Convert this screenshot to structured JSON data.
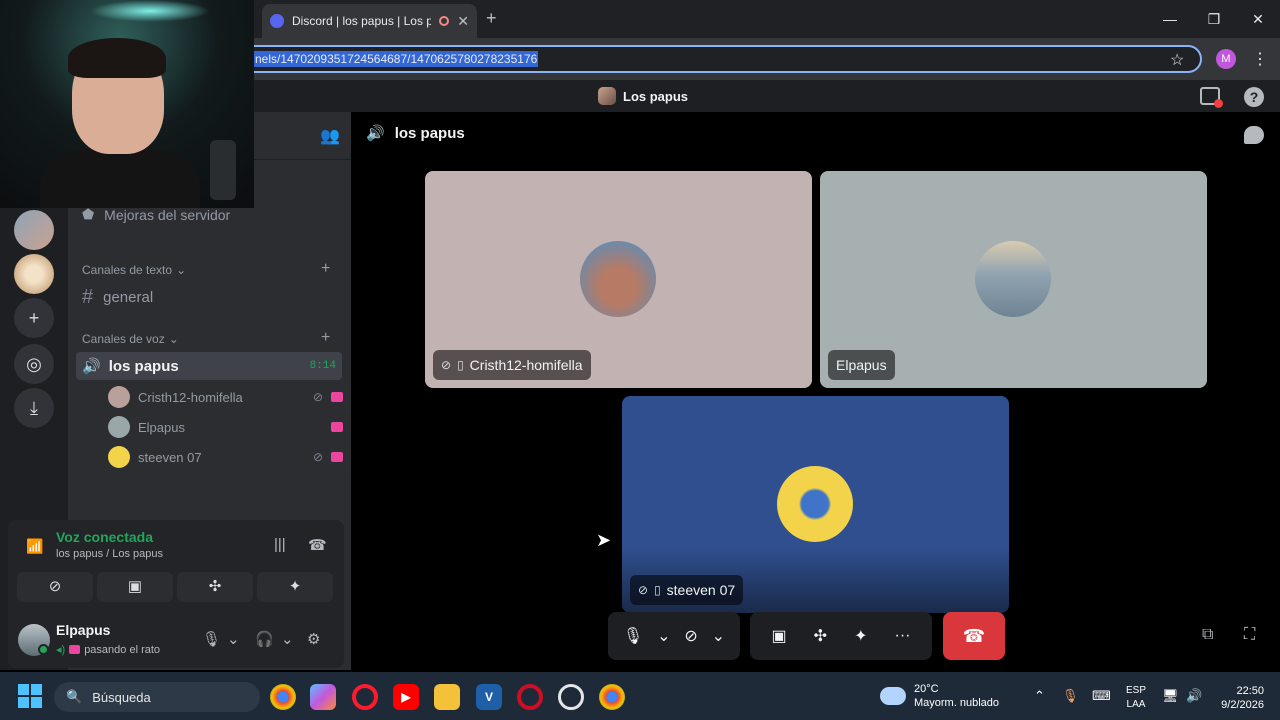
{
  "browser": {
    "tab_title": "Discord | los papus | Los papus",
    "new_tab": "+",
    "url": "nels/1470209351724564687/1470625780278235176",
    "profile_initial": "M",
    "window_controls": [
      "—",
      "❐",
      "✕"
    ]
  },
  "discord_titlebar": {
    "server_name": "Los papus"
  },
  "sidebar": {
    "boost_label": "Mejoras del servidor",
    "text_category": "Canales de texto",
    "text_channels": [
      "general"
    ],
    "voice_category": "Canales de voz",
    "voice_channel": {
      "name": "los papus",
      "timer": "8:14"
    },
    "voice_users": [
      {
        "name": "Cristh12-homifella",
        "muted_video": true,
        "live": true,
        "avatar_color": "#b9a09a"
      },
      {
        "name": "Elpapus",
        "muted_video": false,
        "live": true,
        "avatar_color": "#9aa7a8"
      },
      {
        "name": "steeven 07",
        "muted_video": true,
        "live": true,
        "avatar_color": "#f2d34a"
      }
    ]
  },
  "voice_panel": {
    "status": "Voz conectada",
    "location": "los papus / Los papus"
  },
  "user": {
    "name": "Elpapus",
    "activity": "pasando el rato"
  },
  "call": {
    "channel_title": "los papus",
    "tiles": [
      {
        "name": "Cristh12-homifella",
        "bg": "#c3b2b2",
        "show_icons": true
      },
      {
        "name": "Elpapus",
        "bg": "#a6b0b1",
        "show_icons": false
      },
      {
        "name": "steeven 07",
        "bg": "#2f4f8f",
        "show_icons": true
      }
    ]
  },
  "taskbar": {
    "search_placeholder": "Búsqueda",
    "weather_temp": "20°C",
    "weather_desc": "Mayorm. nublado",
    "lang_top": "ESP",
    "lang_bottom": "LAA",
    "time": "22:50",
    "date": "9/2/2026"
  },
  "colors": {
    "accent_green": "#23a55a",
    "hangup_red": "#da373c",
    "discord_blurple": "#5865f2"
  }
}
